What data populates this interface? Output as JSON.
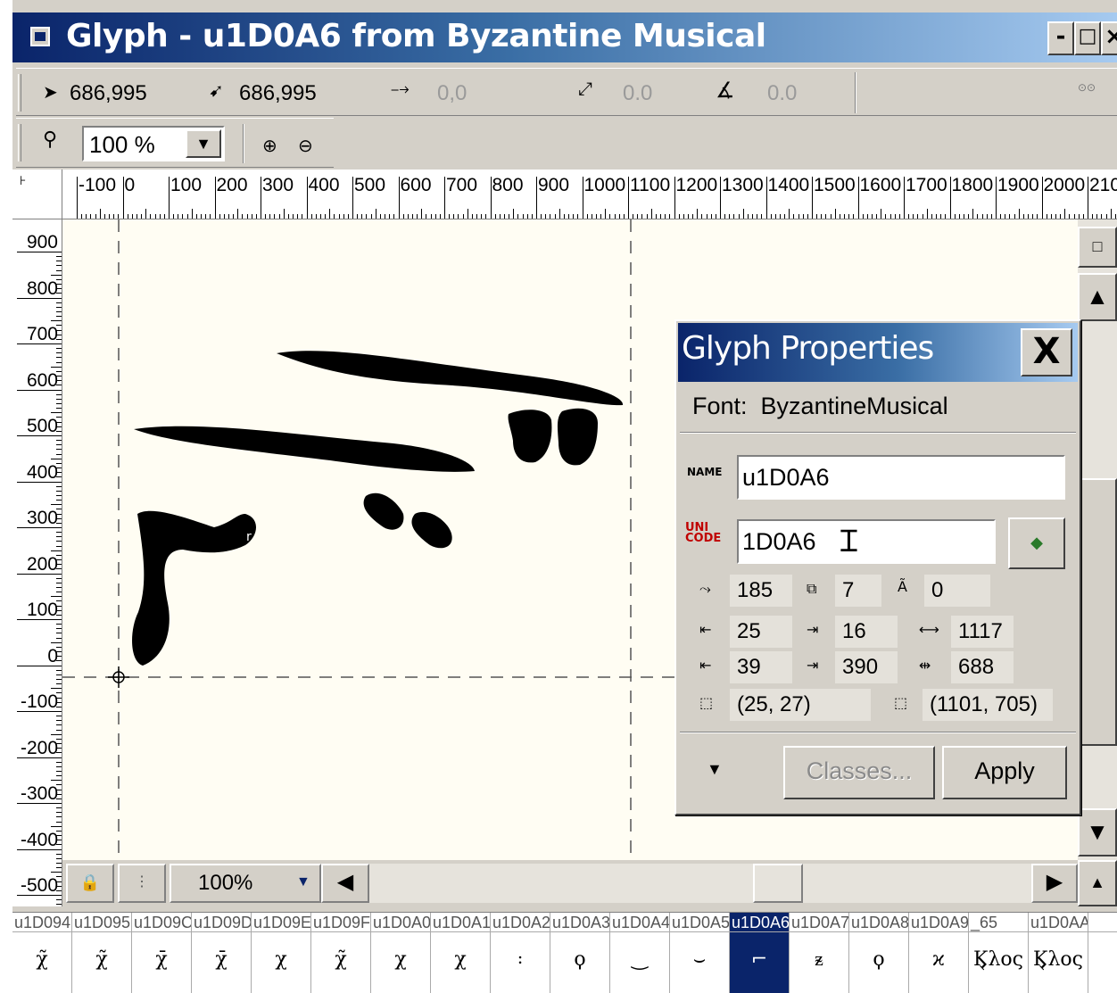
{
  "window": {
    "title": "Glyph - u1D0A6 from Byzantine Musical",
    "controls": {
      "minimize": "-",
      "maximize": "□",
      "close": "×"
    }
  },
  "toolbar": {
    "pointer_coord": "686,995",
    "snap_coord": "686,995",
    "offset": "0,0",
    "distance": "0.0",
    "angle": "0.0",
    "zoom_value": "100 %"
  },
  "ruler": {
    "horizontal_labels": [
      "-100",
      "0",
      "100",
      "200",
      "300",
      "400",
      "500",
      "600",
      "700",
      "800",
      "900",
      "1000",
      "1100",
      "1200",
      "1300",
      "1400",
      "1500",
      "1600",
      "1700",
      "1800",
      "1900",
      "2000",
      "210"
    ],
    "vertical_labels": [
      "900",
      "800",
      "700",
      "600",
      "500",
      "400",
      "300",
      "200",
      "100",
      "0",
      "-100",
      "-200",
      "-300",
      "-400",
      "-500"
    ]
  },
  "statusbar": {
    "zoom": "100%"
  },
  "glyph_properties": {
    "title": "Glyph Properties",
    "close": "X",
    "font_label": "Font:",
    "font_name": "ByzantineMusical",
    "name_value": "u1D0A6",
    "unicode_value": "1D0A6",
    "metrics": {
      "m1": "185",
      "m2": "7",
      "m3": "0",
      "left_bearing": "25",
      "right_bearing": "16",
      "width": "1117",
      "m7": "39",
      "m8": "390",
      "m9": "688",
      "min_point": "(25, 27)",
      "max_point": "(1101, 705)"
    },
    "classes_button": "Classes...",
    "apply_button": "Apply"
  },
  "cell_headers": [
    "u1D094",
    "u1D095",
    "u1D09C",
    "u1D09D",
    "u1D09E",
    "u1D09F",
    "u1D0A0",
    "u1D0A1",
    "u1D0A2",
    "u1D0A3",
    "u1D0A4",
    "u1D0A5",
    "u1D0A6",
    "u1D0A7",
    "u1D0A8",
    "u1D0A9",
    "_65",
    "u1D0AA"
  ],
  "cell_glyphs": [
    "χ̃",
    "χ̃",
    "χ̄",
    "χ̄",
    "χ",
    "χ̃",
    "χ",
    "χ",
    "꞉",
    "ϙ",
    "‿",
    "⌣",
    "⌐",
    "ᵶ",
    "ϙ",
    "ϰ",
    "Ϗλος",
    "Ϗλος"
  ]
}
